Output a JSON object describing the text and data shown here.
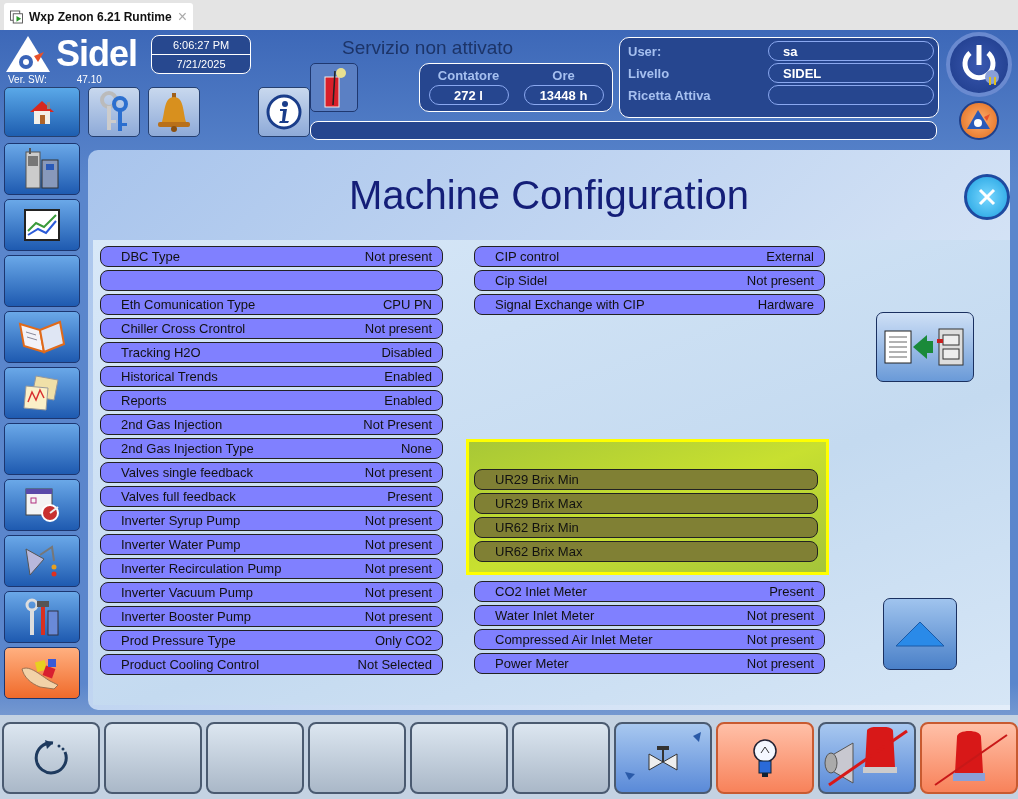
{
  "browser_tab": {
    "title": "Wxp Zenon 6.21 Runtime",
    "close": "×"
  },
  "header": {
    "logo": "Sidel",
    "version_label": "Ver. SW:",
    "version": "47.10",
    "time": "6:06:27 PM",
    "date": "7/21/2025",
    "service_status": "Servizio non attivato",
    "counters": [
      {
        "label": "Contatore",
        "value": "272 l"
      },
      {
        "label": "Ore",
        "value": "13448 h"
      }
    ],
    "user_info": [
      {
        "label": "User:",
        "value": "sa"
      },
      {
        "label": "Livello",
        "value": "SIDEL"
      },
      {
        "label": "Ricetta Attiva"
      }
    ]
  },
  "toolbar": [
    {
      "kind": "home",
      "selected": false
    },
    {
      "kind": "keys",
      "selected": false
    },
    {
      "kind": "bell",
      "selected": false
    },
    {
      "kind": "info",
      "selected": false
    }
  ],
  "sidebar": [
    {
      "kind": "machine",
      "selected": false
    },
    {
      "kind": "trend",
      "selected": false
    },
    {
      "kind": "blank",
      "selected": false
    },
    {
      "kind": "manual",
      "selected": false
    },
    {
      "kind": "report",
      "selected": false
    },
    {
      "kind": "blank",
      "selected": false
    },
    {
      "kind": "scheduler",
      "selected": false
    },
    {
      "kind": "lamp",
      "selected": false
    },
    {
      "kind": "tools",
      "selected": false
    },
    {
      "kind": "hand",
      "selected": true
    }
  ],
  "page": {
    "title": "Machine Configuration",
    "left_settings": [
      {
        "kind": "setting",
        "label": "DBC Type",
        "value": "Not present"
      },
      {
        "kind": "blank"
      },
      {
        "kind": "setting",
        "label": "Eth Comunication Type",
        "value": "CPU PN"
      },
      {
        "kind": "setting",
        "label": "Chiller Cross Crontrol",
        "value": "Not present"
      },
      {
        "kind": "setting",
        "label": "Tracking H2O",
        "value": "Disabled"
      },
      {
        "kind": "setting",
        "label": "Historical Trends",
        "value": "Enabled"
      },
      {
        "kind": "setting",
        "label": "Reports",
        "value": "Enabled"
      },
      {
        "kind": "setting",
        "label": "2nd Gas Injection",
        "value": "Not Present"
      },
      {
        "kind": "setting",
        "label": "2nd Gas Injection Type",
        "value": "None"
      },
      {
        "kind": "setting",
        "label": "Valves single feedback",
        "value": "Not present"
      },
      {
        "kind": "setting",
        "label": "Valves full feedback",
        "value": "Present"
      },
      {
        "kind": "setting",
        "label": "Inverter Syrup Pump",
        "value": "Not present"
      },
      {
        "kind": "setting",
        "label": "Inverter Water Pump",
        "value": "Not present"
      },
      {
        "kind": "setting",
        "label": "Inverter Recirculation Pump",
        "value": "Not present"
      },
      {
        "kind": "setting",
        "label": "Inverter Vacuum Pump",
        "value": "Not present"
      },
      {
        "kind": "setting",
        "label": "Inverter Booster Pump",
        "value": "Not present"
      },
      {
        "kind": "setting",
        "label": "Prod Pressure Type",
        "value": "Only CO2"
      },
      {
        "kind": "setting",
        "label": "Product Cooling Control",
        "value": "Not Selected"
      }
    ],
    "cip_settings": [
      {
        "label": "CIP control",
        "value": "External"
      },
      {
        "label": "Cip Sidel",
        "value": "Not present"
      },
      {
        "label": "Signal Exchange with CIP",
        "value": "Hardware"
      }
    ],
    "brix_settings": [
      {
        "label": "UR29 Brix Min"
      },
      {
        "label": "UR29 Brix Max"
      },
      {
        "label": "UR62 Brix Min"
      },
      {
        "label": "UR62 Brix Max"
      }
    ],
    "meter_settings": [
      {
        "label": "CO2 Inlet Meter",
        "value": "Present"
      },
      {
        "label": "Water Inlet Meter",
        "value": "Not present"
      },
      {
        "label": "Compressed Air Inlet Meter",
        "value": "Not present"
      },
      {
        "label": "Power Meter",
        "value": "Not present"
      }
    ]
  },
  "footer_buttons": [
    {
      "kind": "refresh",
      "alert": false
    },
    {
      "kind": "blank",
      "alert": false
    },
    {
      "kind": "blank",
      "alert": false
    },
    {
      "kind": "blank",
      "alert": false
    },
    {
      "kind": "blank",
      "alert": false
    },
    {
      "kind": "blank",
      "alert": false
    },
    {
      "kind": "valve",
      "alert": false
    },
    {
      "kind": "bulb",
      "alert": true
    },
    {
      "kind": "horn-off",
      "alert": false
    },
    {
      "kind": "beacon-off",
      "alert": true
    }
  ]
}
